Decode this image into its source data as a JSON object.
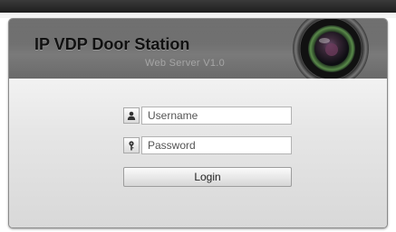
{
  "header": {
    "title": "IP VDP Door Station",
    "subtitle": "Web Server V1.0"
  },
  "login_form": {
    "username": {
      "value": "",
      "placeholder": "Username",
      "icon": "user-icon"
    },
    "password": {
      "value": "",
      "placeholder": "Password",
      "icon": "key-icon"
    },
    "login_label": "Login"
  },
  "colors": {
    "header_bg": "#727272",
    "title_text": "#111111",
    "subtitle_text": "#a6a6a6",
    "panel_bg": "#dedede",
    "top_bar": "#2a2a2a"
  }
}
